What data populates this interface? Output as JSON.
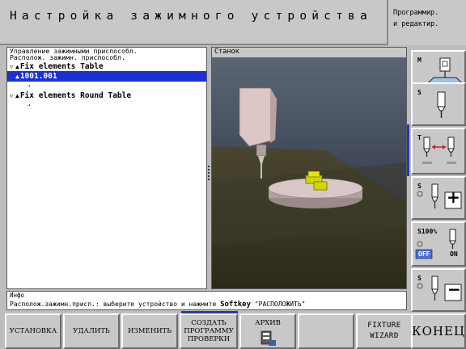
{
  "header": {
    "title": "Настройка зажимного устройства",
    "mode_line1": "Программир.",
    "mode_line2": "и редактир."
  },
  "tree": {
    "header_line1": "Управление зажимными приспособл.",
    "header_line2": "Располож. зажимн. приспособл.",
    "items": [
      {
        "label": "Fix elements Table"
      },
      {
        "label": "1001.001",
        "selected": true
      },
      {
        "label": ""
      },
      {
        "label": "Fix elements Round Table"
      },
      {
        "label": ""
      }
    ]
  },
  "view": {
    "label": "Станок"
  },
  "right_softkeys": [
    {
      "label": "M",
      "icon": "tool-holder-icon"
    },
    {
      "label": "S",
      "icon": "spindle-icon"
    },
    {
      "label": "T",
      "icon": "tool-change-icon"
    },
    {
      "label": "S",
      "icon": "spindle-plus-icon",
      "action": "+"
    },
    {
      "label": "S100%",
      "icon": "spindle-override-icon",
      "off": "OFF",
      "on": "ON"
    },
    {
      "label": "S",
      "icon": "spindle-minus-icon",
      "action": "−"
    }
  ],
  "info": {
    "title": "Инфо",
    "text_prefix": "Располож.зажимн.присп.: выберите устройство и нажмите ",
    "text_key": "Softkey",
    "text_suffix": " \"РАСПОЛОЖИТЬ\""
  },
  "bottom_softkeys": [
    {
      "lines": [
        "УСТАНОВКА"
      ]
    },
    {
      "lines": [
        "УДАЛИТЬ"
      ]
    },
    {
      "lines": [
        "ИЗМЕНИТЬ"
      ]
    },
    {
      "lines": [
        "СОЗДАТЬ",
        "ПРОГРАММУ",
        "ПРОВЕРКИ"
      ]
    },
    {
      "lines": [
        "АРХИВ"
      ],
      "icon": "archive-icon"
    },
    {
      "lines": []
    },
    {
      "lines": [
        "FIXTURE",
        "WIZARD"
      ]
    },
    {
      "lines": [
        "КОНЕЦ"
      ]
    }
  ],
  "colors": {
    "selection": "#1a2fd6",
    "accent": "#2236c8",
    "panel": "#c8c8c8"
  }
}
